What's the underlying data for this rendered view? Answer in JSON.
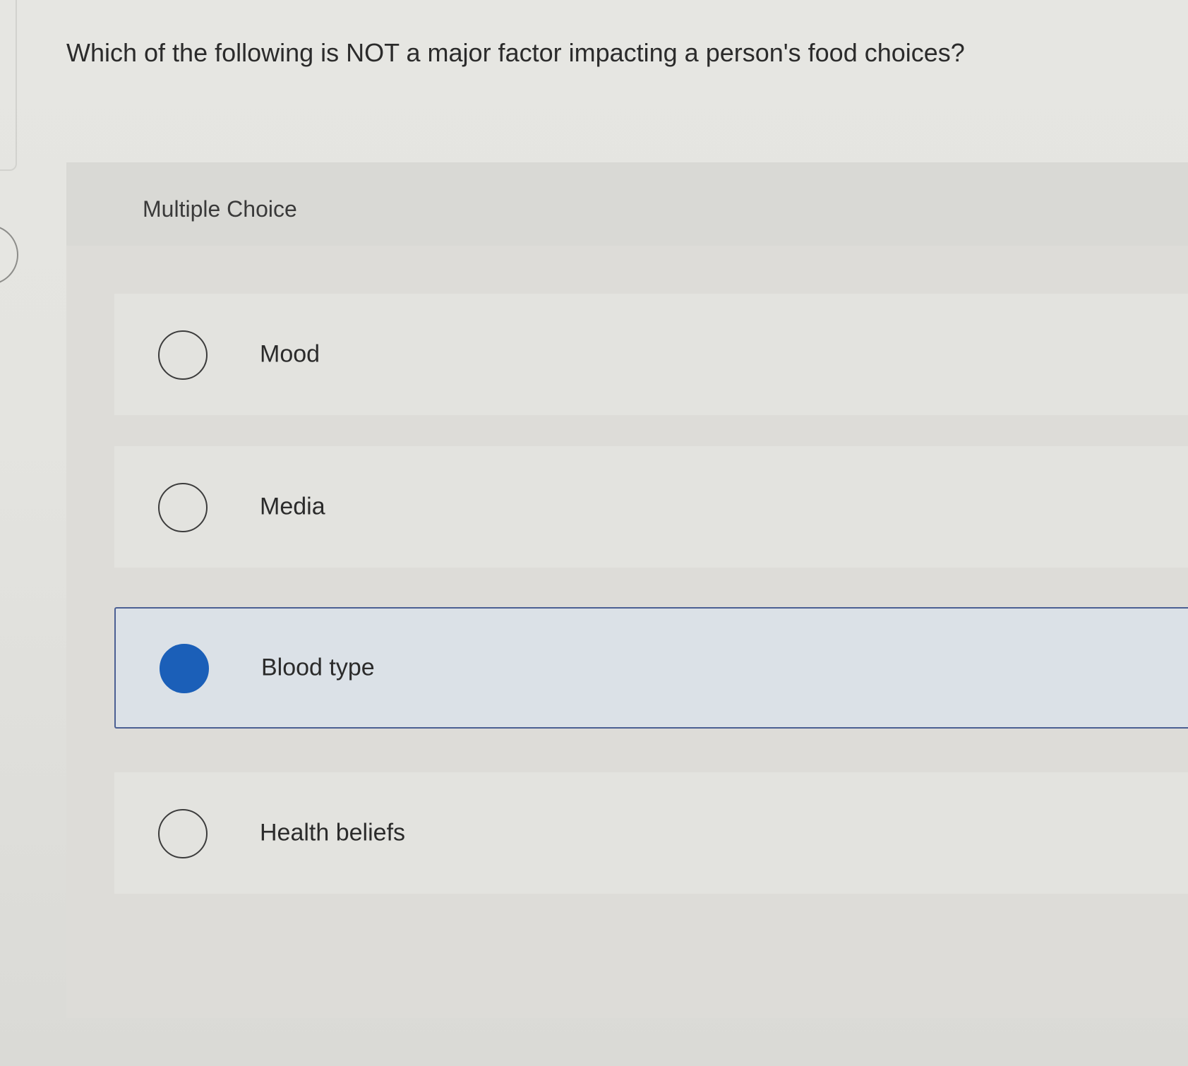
{
  "question": {
    "text": "Which of the following is NOT a major factor impacting a person's food choices?"
  },
  "panel": {
    "label": "Multiple Choice"
  },
  "options": [
    {
      "label": "Mood",
      "selected": false
    },
    {
      "label": "Media",
      "selected": false
    },
    {
      "label": "Blood type",
      "selected": true
    },
    {
      "label": "Health beliefs",
      "selected": false
    }
  ],
  "colors": {
    "accent": "#1b5fb8",
    "selected_border": "#4b5f93",
    "selected_background": "#dbe1e7"
  }
}
